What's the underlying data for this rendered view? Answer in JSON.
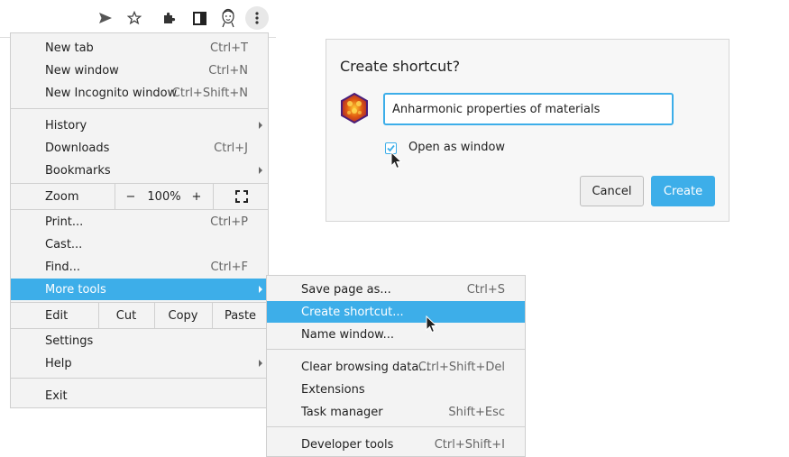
{
  "menu": {
    "items": [
      {
        "label": "New tab",
        "shortcut": "Ctrl+T"
      },
      {
        "label": "New window",
        "shortcut": "Ctrl+N"
      },
      {
        "label": "New Incognito window",
        "shortcut": "Ctrl+Shift+N"
      },
      {
        "label": "History",
        "shortcut": ""
      },
      {
        "label": "Downloads",
        "shortcut": "Ctrl+J"
      },
      {
        "label": "Bookmarks",
        "shortcut": ""
      },
      {
        "label": "Print...",
        "shortcut": "Ctrl+P"
      },
      {
        "label": "Cast...",
        "shortcut": ""
      },
      {
        "label": "Find...",
        "shortcut": "Ctrl+F"
      },
      {
        "label": "More tools",
        "shortcut": ""
      },
      {
        "label": "Settings",
        "shortcut": ""
      },
      {
        "label": "Help",
        "shortcut": ""
      },
      {
        "label": "Exit",
        "shortcut": ""
      }
    ],
    "zoom": {
      "label": "Zoom",
      "minus": "−",
      "value": "100%",
      "plus": "+"
    },
    "edit": {
      "label": "Edit",
      "cut": "Cut",
      "copy": "Copy",
      "paste": "Paste"
    }
  },
  "submenu": {
    "items": [
      {
        "label": "Save page as...",
        "shortcut": "Ctrl+S"
      },
      {
        "label": "Create shortcut...",
        "shortcut": ""
      },
      {
        "label": "Name window...",
        "shortcut": ""
      },
      {
        "label": "Clear browsing data...",
        "shortcut": "Ctrl+Shift+Del"
      },
      {
        "label": "Extensions",
        "shortcut": ""
      },
      {
        "label": "Task manager",
        "shortcut": "Shift+Esc"
      },
      {
        "label": "Developer tools",
        "shortcut": "Ctrl+Shift+I"
      }
    ]
  },
  "dialog": {
    "title": "Create shortcut?",
    "name_value": "Anharmonic properties of materials",
    "open_as_window_label": "Open as window",
    "open_as_window_checked": true,
    "cancel_label": "Cancel",
    "create_label": "Create"
  },
  "toolbar": {
    "icons": [
      "send-icon",
      "star-icon",
      "extensions-puzzle-icon",
      "side-panel-icon",
      "profile-avatar-icon",
      "more-menu-icon"
    ]
  },
  "colors": {
    "accent": "#3daee9",
    "menu_bg": "#f3f3f3",
    "dialog_bg": "#f7f7f7"
  }
}
